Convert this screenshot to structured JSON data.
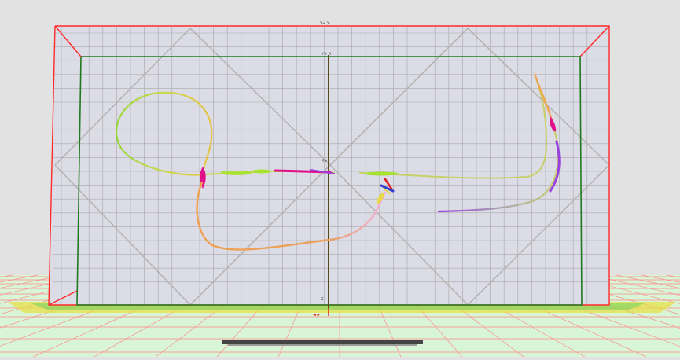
{
  "scene": {
    "background": "#e2e2e2",
    "floor_color": "#d8f5d8",
    "floor_grid_color": "#ff8a8a",
    "outer_frame_color": "#ff2a2a",
    "inner_frame_color": "#1f7a1f",
    "axis_color": "#5a4a1a",
    "wall_grid_color": "#a8a8a8",
    "wall_fill": "#dcdce6"
  },
  "labels": {
    "top_axis": "Y+ Y-",
    "inner_top_axis": "Y+ X",
    "mid_axis": "X+",
    "bottom_axis": "Z+",
    "bottom_small": "◄ ►"
  },
  "colors": {
    "ribbon_green": "#a6e22e",
    "ribbon_yellow": "#e6d84a",
    "ribbon_orange": "#f0a050",
    "ribbon_magenta": "#e0108a",
    "ribbon_purple": "#9a40e0",
    "ribbon_red": "#e02020",
    "ribbon_blue": "#3040d0",
    "scrollbar": "#444444"
  }
}
